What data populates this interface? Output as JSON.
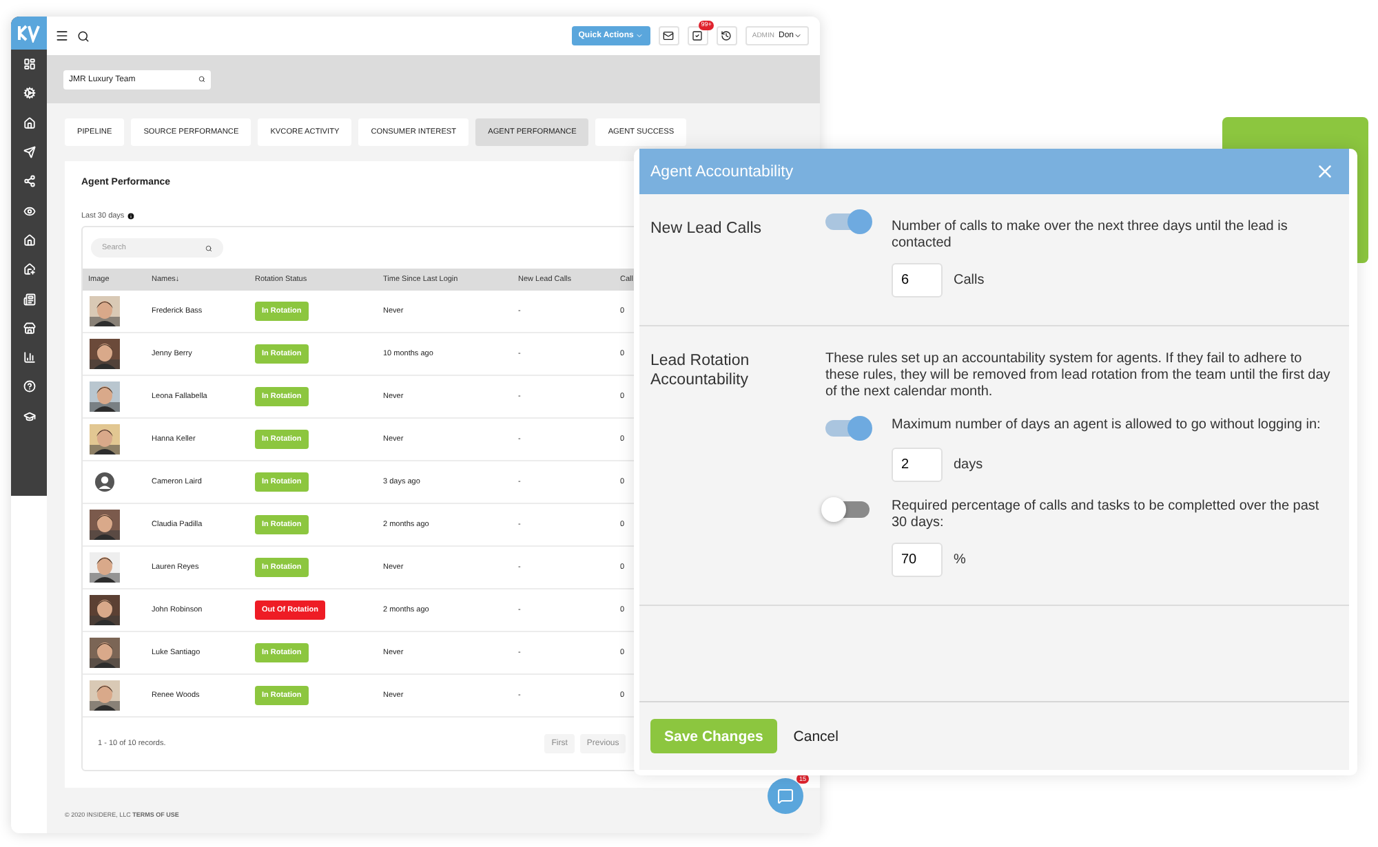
{
  "topbar": {
    "quick_actions": "Quick Actions",
    "task_badge": "99+",
    "role": "ADMIN",
    "user": "Don"
  },
  "team_search": {
    "value": "JMR Luxury Team"
  },
  "tabs": [
    {
      "label": "PIPELINE",
      "selected": false
    },
    {
      "label": "SOURCE PERFORMANCE",
      "selected": false
    },
    {
      "label": "KVCORE ACTIVITY",
      "selected": false
    },
    {
      "label": "CONSUMER INTEREST",
      "selected": false
    },
    {
      "label": "AGENT PERFORMANCE",
      "selected": true
    },
    {
      "label": "AGENT SUCCESS",
      "selected": false
    }
  ],
  "card": {
    "title": "Agent Performance",
    "period": "Last 30 days"
  },
  "table": {
    "search": {
      "placeholder": "Search"
    },
    "columns": [
      "Image",
      "Names↓",
      "Rotation Status",
      "Time Since Last Login",
      "New Lead Calls",
      "Call"
    ],
    "rows": [
      {
        "name": "Frederick Bass",
        "status": "In Rotation",
        "in_rotation": true,
        "last_login": "Never",
        "new_lead_calls": "-",
        "calls": "0"
      },
      {
        "name": "Jenny Berry",
        "status": "In Rotation",
        "in_rotation": true,
        "last_login": "10 months ago",
        "new_lead_calls": "-",
        "calls": "0"
      },
      {
        "name": "Leona Fallabella",
        "status": "In Rotation",
        "in_rotation": true,
        "last_login": "Never",
        "new_lead_calls": "-",
        "calls": "0"
      },
      {
        "name": "Hanna Keller",
        "status": "In Rotation",
        "in_rotation": true,
        "last_login": "Never",
        "new_lead_calls": "-",
        "calls": "0"
      },
      {
        "kind": "placeholder",
        "name": "Cameron Laird",
        "status": "In Rotation",
        "in_rotation": true,
        "last_login": "3 days ago",
        "new_lead_calls": "-",
        "calls": "0"
      },
      {
        "name": "Claudia Padilla",
        "status": "In Rotation",
        "in_rotation": true,
        "last_login": "2 months ago",
        "new_lead_calls": "-",
        "calls": "0"
      },
      {
        "name": "Lauren Reyes",
        "status": "In Rotation",
        "in_rotation": true,
        "last_login": "Never",
        "new_lead_calls": "-",
        "calls": "0"
      },
      {
        "name": "John Robinson",
        "status": "Out Of Rotation",
        "in_rotation": false,
        "last_login": "2 months ago",
        "new_lead_calls": "-",
        "calls": "0"
      },
      {
        "name": "Luke Santiago",
        "status": "In Rotation",
        "in_rotation": true,
        "last_login": "Never",
        "new_lead_calls": "-",
        "calls": "0"
      },
      {
        "name": "Renee Woods",
        "status": "In Rotation",
        "in_rotation": true,
        "last_login": "Never",
        "new_lead_calls": "-",
        "calls": "0"
      }
    ],
    "records": "1 - 10 of 10 records.",
    "pager": [
      {
        "label": "First",
        "disabled": true
      },
      {
        "label": "Previous",
        "disabled": true
      }
    ]
  },
  "footer": "© 2020 INSIDERE, LLC **TERMS OF USE**",
  "chat": {
    "badge": "15"
  },
  "modal": {
    "title": "Agent Accountability",
    "sections": [
      {
        "label": "New Lead Calls",
        "rules": [
          {
            "on": true,
            "text": "Number of calls to make over the next three days until the lead is contacted",
            "value": "6",
            "unit": "Calls"
          }
        ]
      },
      {
        "label": "Lead Rotation Accountability",
        "intro": "These rules set up an accountability system for agents. If they fail to adhere to these rules, they will be removed from lead rotation from the team until the first day of the next calendar month.",
        "rules": [
          {
            "on": true,
            "text": "Maximum number of days an agent is allowed to go without logging in:",
            "value": "2",
            "unit": "days"
          },
          {
            "on": false,
            "text": "Required percentage of calls and tasks to be completted over the past 30 days:",
            "value": "70",
            "unit": "%"
          }
        ]
      }
    ],
    "save": "Save Changes",
    "cancel": "Cancel"
  }
}
